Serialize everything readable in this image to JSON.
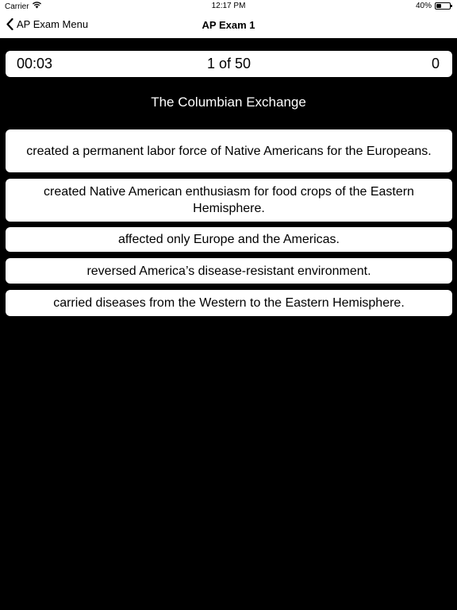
{
  "status_bar": {
    "carrier": "Carrier",
    "time": "12:17 PM",
    "battery_percent_label": "40%",
    "battery_level": 0.4,
    "wifi_icon": "wifi-icon",
    "battery_icon": "battery-icon"
  },
  "nav": {
    "back_label": "AP Exam Menu",
    "title": "AP Exam 1"
  },
  "quiz": {
    "timer": "00:03",
    "progress": "1 of 50",
    "score": "0",
    "question": "The Columbian Exchange",
    "answers": [
      "created a permanent labor force of Native Americans for the Europeans.",
      "created Native American enthusiasm for food crops of the Eastern Hemisphere.",
      "affected only Europe and the Americas.",
      "reversed America’s disease-resistant environment.",
      "carried diseases from the Western to the Eastern Hemisphere."
    ]
  },
  "colors": {
    "background": "#000000",
    "card": "#ffffff",
    "text_dark": "#000000",
    "text_light": "#ffffff"
  }
}
